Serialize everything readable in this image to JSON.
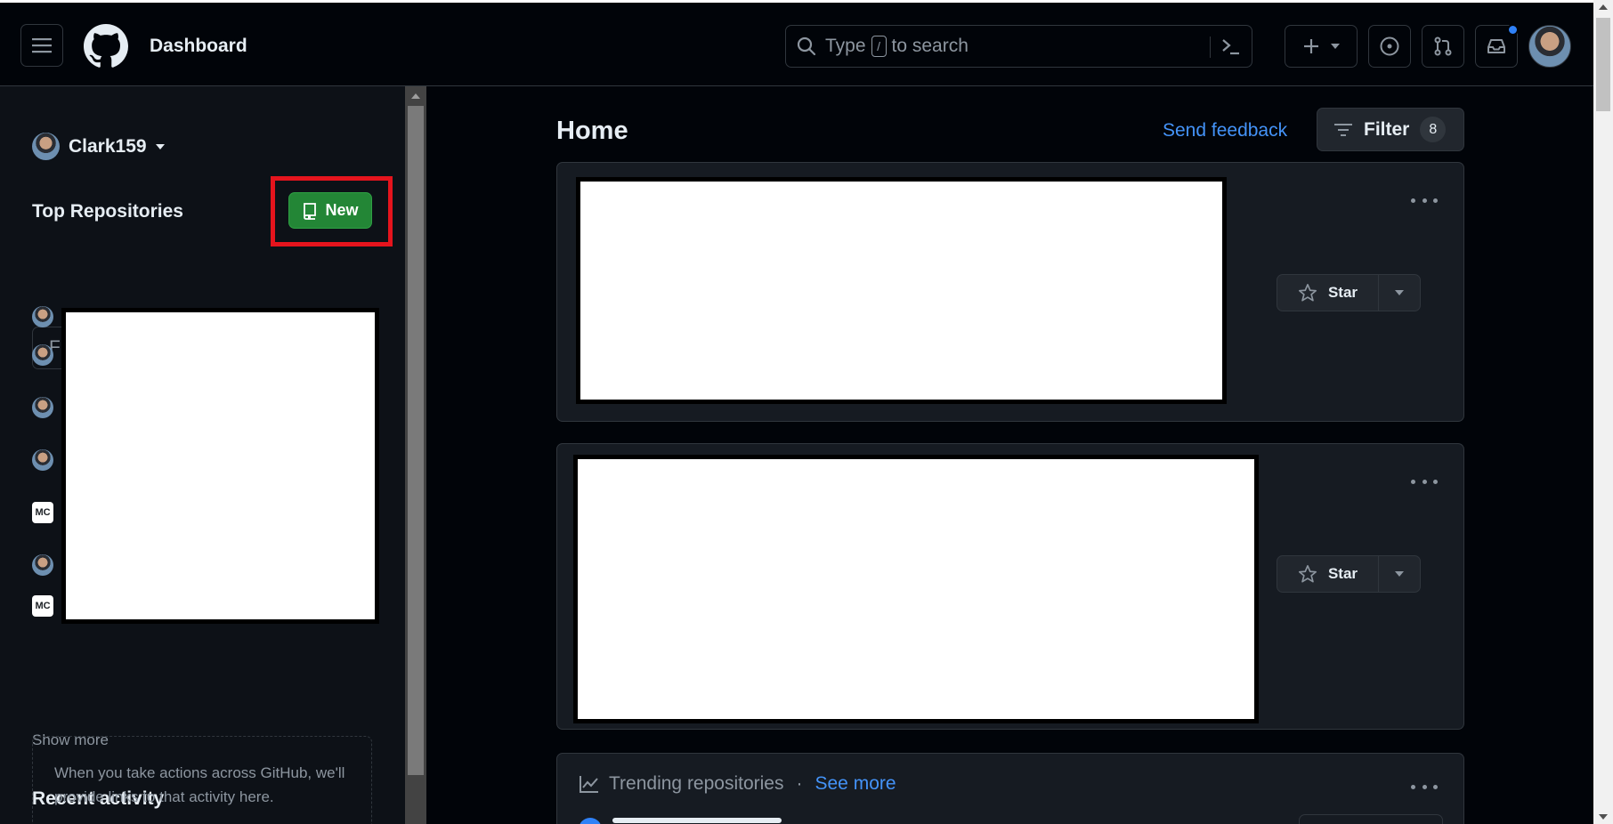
{
  "header": {
    "title": "Dashboard",
    "search": {
      "prefix": "Type",
      "kbd": "/",
      "suffix": "to search"
    }
  },
  "sidebar": {
    "username": "Clark159",
    "top_repos_label": "Top Repositories",
    "new_button": "New",
    "find_placeholder": "Find a repository…",
    "show_more": "Show more",
    "recent_activity_label": "Recent activity",
    "recent_activity_empty": "When you take actions across GitHub, we'll provide links to that activity here.",
    "repo_owner_icons": [
      "user-avatar",
      "user-avatar",
      "user-avatar",
      "user-avatar",
      "org-logo",
      "user-avatar",
      "org-logo"
    ],
    "org_logo_text": "MC"
  },
  "main": {
    "title": "Home",
    "send_feedback": "Send feedback",
    "filter_label": "Filter",
    "filter_count": "8",
    "cards": [
      {
        "star_label": "Star"
      },
      {
        "star_label": "Star"
      }
    ],
    "trending": {
      "title": "Trending repositories",
      "separator": "·",
      "see_more": "See more"
    }
  },
  "colors": {
    "background": "#010409",
    "surface": "#161b22",
    "border": "#30363d",
    "accent_link": "#4493f8",
    "new_button": "#238636",
    "highlight": "#e5141d"
  }
}
